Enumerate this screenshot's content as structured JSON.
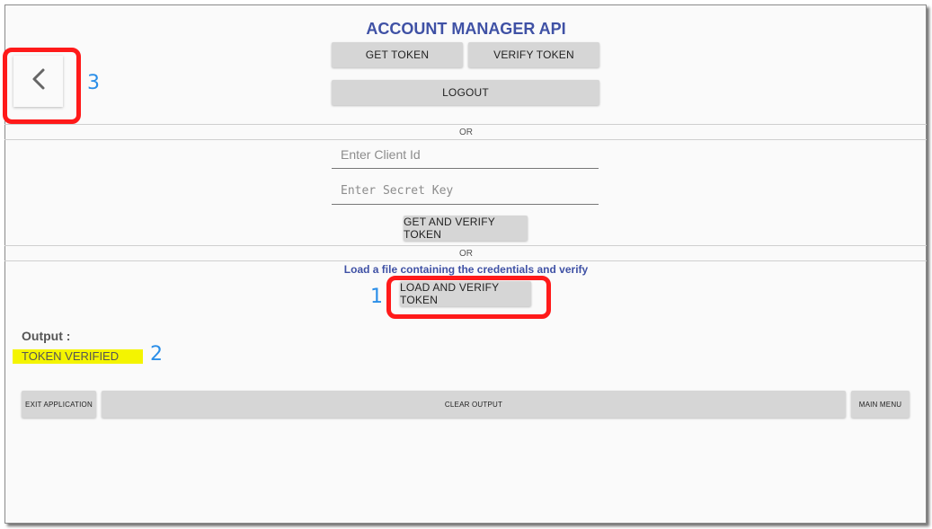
{
  "header": {
    "title": "ACCOUNT MANAGER API"
  },
  "buttons": {
    "get_token": "GET TOKEN",
    "verify_token": "VERIFY TOKEN",
    "logout": "LOGOUT",
    "get_and_verify": "GET AND VERIFY TOKEN",
    "load_and_verify": "LOAD AND VERIFY TOKEN",
    "exit_application": "EXIT APPLICATION",
    "clear_output": "CLEAR OUTPUT",
    "main_menu": "MAIN MENU"
  },
  "separators": {
    "or_1": "OR",
    "or_2": "OR"
  },
  "form": {
    "client_id": {
      "placeholder": "Enter Client Id",
      "value": ""
    },
    "secret_key": {
      "placeholder": "Enter Secret Key",
      "value": ""
    }
  },
  "file_section": {
    "hint": "Load a file containing the credentials and verify"
  },
  "output": {
    "label": "Output :",
    "value": "TOKEN VERIFIED"
  },
  "annotations": {
    "n1": "1",
    "n2": "2",
    "n3": "3"
  },
  "icons": {
    "back": "chevron-left-icon"
  },
  "colors": {
    "title": "#3f51a5",
    "highlight": "#f4f400",
    "annotation_box": "#ff1a1a",
    "annotation_number": "#2a8ee8",
    "button_bg": "#d6d6d6"
  }
}
